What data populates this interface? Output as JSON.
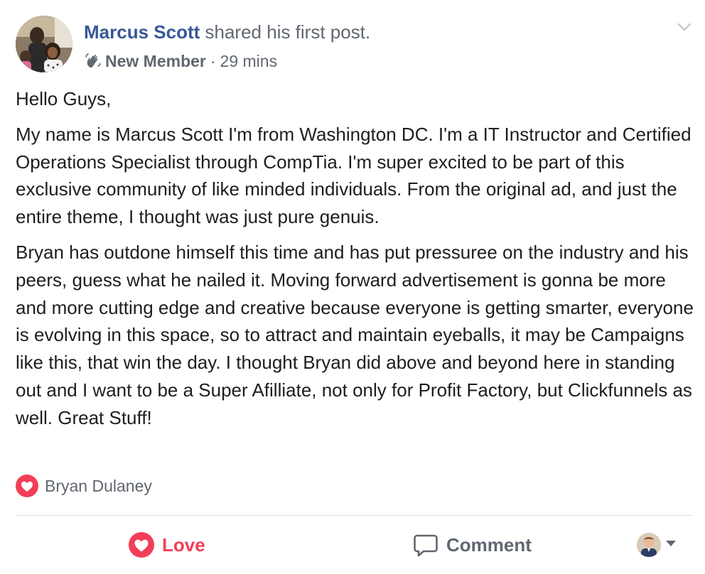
{
  "post": {
    "author_name": "Marcus Scott",
    "action_text": "shared his first post.",
    "member_badge": "New Member",
    "separator": "·",
    "timestamp": "29 mins",
    "body": {
      "greeting": "Hello Guys,",
      "paragraph1": "My name is Marcus Scott I'm from Washington DC. I'm a IT Instructor and Certified Operations Specialist through CompTia. I'm super excited to be part of this exclusive community of like minded individuals. From the original ad, and just the entire theme, I thought was just pure genuis.",
      "paragraph2": "Bryan has outdone himself this time and has put pressuree on the industry and his peers, guess what he nailed it. Moving forward advertisement is gonna be more and more cutting edge and creative because everyone is getting smarter, everyone is evolving in this space, so to attract and maintain eyeballs, it may be Campaigns like this, that win the day. I thought Bryan did above and beyond here in standing out and I want to be a Super Afilliate, not only for Profit Factory, but Clickfunnels as well. Great Stuff!"
    },
    "reactions": {
      "icon": "love-reaction-icon",
      "names": "Bryan Dulaney"
    },
    "actions": {
      "love_label": "Love",
      "comment_label": "Comment"
    }
  },
  "colors": {
    "author_link": "#385898",
    "secondary_text": "#616770",
    "love": "#f33e58",
    "divider": "#dadde1"
  }
}
